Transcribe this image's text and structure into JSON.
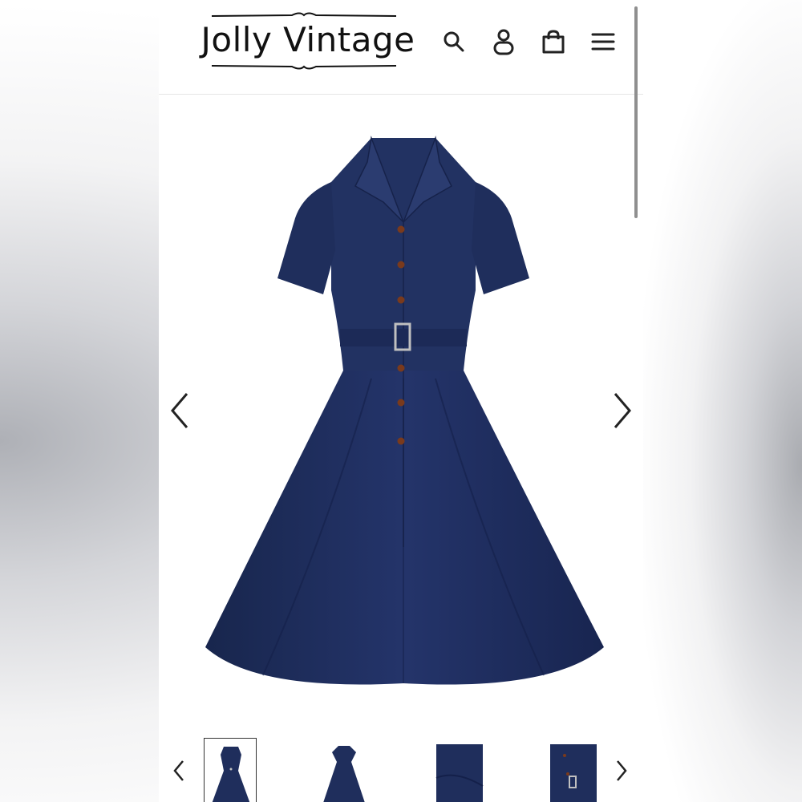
{
  "store": {
    "name": "Jolly Vintage"
  },
  "header": {
    "icons": [
      "search-icon",
      "account-icon",
      "cart-icon",
      "menu-icon"
    ]
  },
  "product": {
    "color": "#1f2f5c",
    "button_color": "#7a3a1c",
    "image_description_name": "navy-shirt-dress"
  },
  "gallery": {
    "prev_icon": "chevron-left-icon",
    "next_icon": "chevron-right-icon",
    "thumbnails": [
      "thumbnail-1",
      "thumbnail-2",
      "thumbnail-3",
      "thumbnail-4"
    ],
    "selected_thumbnail": 1
  },
  "colors": {
    "text": "#111111",
    "divider": "#e6e6e6",
    "scrollbar": "#8f8f8f"
  }
}
